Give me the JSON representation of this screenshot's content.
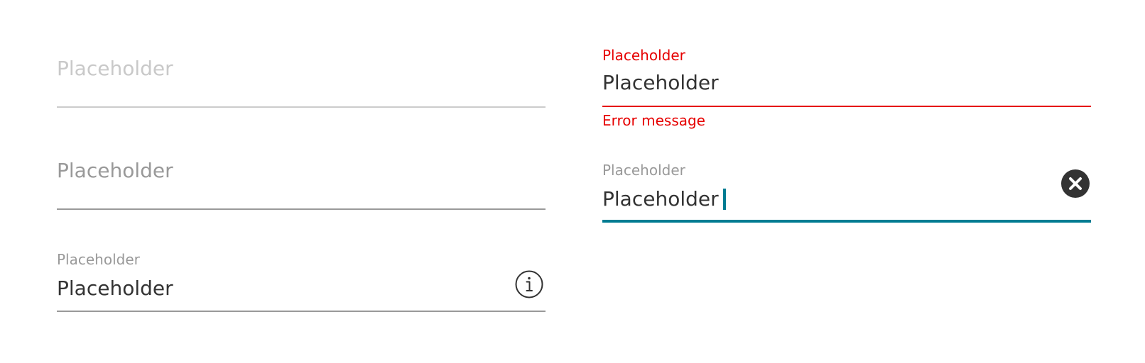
{
  "colors": {
    "error": "#e60000",
    "focus": "#007c92",
    "text": "#333333",
    "muted": "#999999",
    "disabled": "#cccccc"
  },
  "fields": [
    {
      "state": "disabled",
      "placeholder": "Placeholder"
    },
    {
      "state": "default",
      "placeholder": "Placeholder"
    },
    {
      "state": "filled",
      "label": "Placeholder",
      "value": "Placeholder",
      "icon": "info-icon"
    },
    {
      "state": "error",
      "label": "Placeholder",
      "value": "Placeholder",
      "error_message": "Error message"
    },
    {
      "state": "focused",
      "label": "Placeholder",
      "value": "Placeholder",
      "icon": "clear-icon"
    }
  ]
}
